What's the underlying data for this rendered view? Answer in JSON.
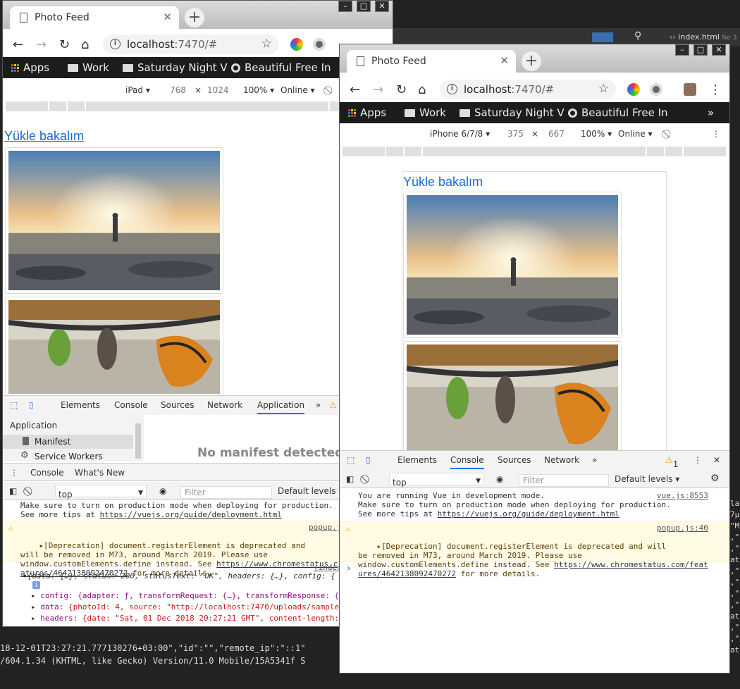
{
  "terminal": {
    "line1": "18-12-01T23:27:21.777130276+03:00\",\"id\":\"\",\"remote_ip\":\"::1\"",
    "line2": "/604.1.34 (KHTML, like Gecko) Version/11.0 Mobile/15A5341f S",
    "right": [
      "la",
      "7µ",
      "\"M",
      ",\"",
      ",\"",
      "at",
      ",\"",
      ",\"",
      ",\"",
      ",\"",
      "at",
      ",\"",
      ",\"",
      "at"
    ],
    "editor_tab": "index.html",
    "editor_tab_extra": "No 3"
  },
  "left": {
    "tab_title": "Photo Feed",
    "url_host": "localhost",
    "url_rest": ":7470/#",
    "bookmarks": [
      "Apps",
      "Work",
      "Saturday Night V",
      "Beautiful Free In"
    ],
    "device": "iPad ▾",
    "width": "768",
    "times": "×",
    "height": "1024",
    "zoom": "100% ▾",
    "network": "Online ▾",
    "upload_link": "Yükle bakalım",
    "devtools_tabs": [
      "Elements",
      "Console",
      "Sources",
      "Network",
      "Application",
      "»"
    ],
    "app_panel_title": "Application",
    "app_items": [
      "Manifest",
      "Service Workers"
    ],
    "no_manifest": "No manifest detected",
    "drawer_tabs": [
      "Console",
      "What's New"
    ],
    "context": "top",
    "filter_placeholder": "Filter",
    "levels": "Default levels ▾",
    "log_prod1": "Make sure to turn on production mode when deploying for production.",
    "log_prod2": "See more tips at ",
    "log_prod_link": "https://vuejs.org/guide/deployment.html",
    "warn1": "▸[Deprecation] document.registerElement is deprecated and",
    "warn2": "will be removed in M73, around March 2019. Please use",
    "warn3": "window.customElements.define instead. See ",
    "warn3_link": "https://www.chromestatus.c",
    "warn4_link": "atures/4642138092470272",
    "warn4": " for more details.",
    "warn_src": "popup.j",
    "obj_src": "(index",
    "obj_line": "{data: {…}, status: 200, statusText: \"OK\", headers: {…}, config: {",
    "obj_config": "config: {adapter: ƒ, transformRequest: {…}, transformResponse: {…",
    "obj_data_key": "data: ",
    "obj_data_val": "{photoId: 4, source: \"http://localhost:7470/uploads/sample_",
    "obj_headers_key": "headers: ",
    "obj_headers_val": "{date: \"Sat, 01 Dec 2018 20:27:21 GMT\", content-length:"
  },
  "right": {
    "tab_title": "Photo Feed",
    "url_host": "localhost",
    "url_rest": ":7470/#",
    "bookmarks": [
      "Apps",
      "Work",
      "Saturday Night V",
      "Beautiful Free In",
      "»"
    ],
    "device": "iPhone 6/7/8 ▾",
    "width": "375",
    "times": "×",
    "height": "667",
    "zoom": "100% ▾",
    "network": "Online ▾",
    "upload_link": "Yükle bakalım",
    "devtools_tabs": [
      "Elements",
      "Console",
      "Sources",
      "Network",
      "»"
    ],
    "warn_count": "1",
    "context": "top",
    "filter_placeholder": "Filter",
    "levels": "Default levels ▾",
    "log1": "You are running Vue in development mode.",
    "log1_src": "vue.js:8553",
    "log2": "Make sure to turn on production mode when deploying for production.",
    "log3": "See more tips at ",
    "log3_link": "https://vuejs.org/guide/deployment.html",
    "warn1": "▸[Deprecation] document.registerElement is deprecated and will",
    "warn1_src": "popup.js:40",
    "warn2": "be removed in M73, around March 2019. Please use",
    "warn3": "window.customElements.define instead. See ",
    "warn3_link": "https://www.chromestatus.com/feat",
    "warn4_link": "ures/4642138092470272",
    "warn4": " for more details.",
    "prompt": "›"
  }
}
